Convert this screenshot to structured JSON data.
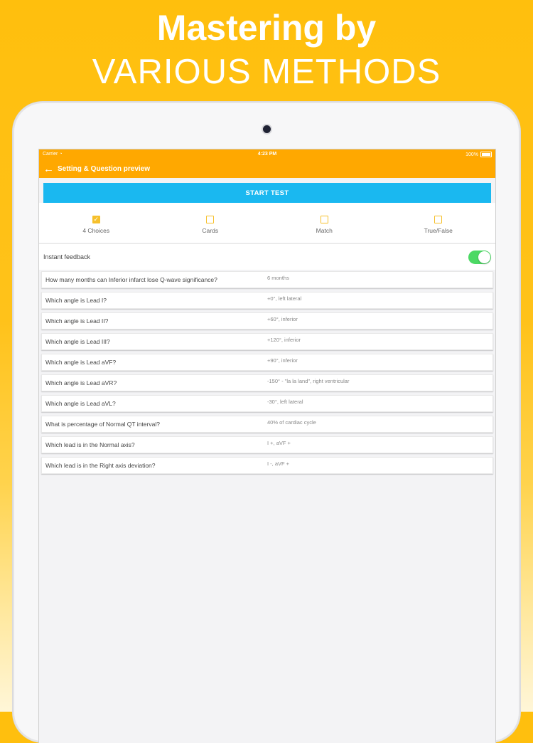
{
  "headline": {
    "line1": "Mastering by",
    "line2": "VARIOUS METHODS"
  },
  "status_bar": {
    "carrier": "Carrier",
    "time": "4:23 PM",
    "battery": "100%"
  },
  "nav": {
    "back_icon": "arrow-left-icon",
    "title": "Setting & Question preview"
  },
  "start_button": "START TEST",
  "modes": [
    {
      "label": "4 Choices",
      "checked": true
    },
    {
      "label": "Cards",
      "checked": false
    },
    {
      "label": "Match",
      "checked": false
    },
    {
      "label": "True/False",
      "checked": false
    }
  ],
  "instant_feedback": {
    "label": "Instant feedback",
    "enabled": true
  },
  "questions": [
    {
      "q": "How many months can Inferior infarct lose Q-wave significance?",
      "a": "6 months"
    },
    {
      "q": "Which angle is Lead I?",
      "a": "+0°, left lateral"
    },
    {
      "q": "Which angle is Lead II?",
      "a": "+60°, inferior"
    },
    {
      "q": "Which angle is Lead III?",
      "a": "+120°, inferior"
    },
    {
      "q": "Which angle is Lead aVF?",
      "a": "+90°, inferior"
    },
    {
      "q": "Which angle is Lead aVR?",
      "a": "-150° - \"la la land\", right ventricular"
    },
    {
      "q": "Which angle is Lead aVL?",
      "a": "-30°, left lateral"
    },
    {
      "q": "What is percentage of Normal QT interval?",
      "a": "40% of cardiac cycle"
    },
    {
      "q": "Which lead is in the Normal axis?",
      "a": "I +, aVF +"
    },
    {
      "q": "Which lead is in the Right axis deviation?",
      "a": "I -, aVF +"
    }
  ],
  "colors": {
    "background": "#ffbf0d",
    "nav_orange": "#ffa800",
    "start_blue": "#1ab8f0",
    "checkbox_yellow": "#f6c02b",
    "toggle_green": "#4cd964"
  }
}
